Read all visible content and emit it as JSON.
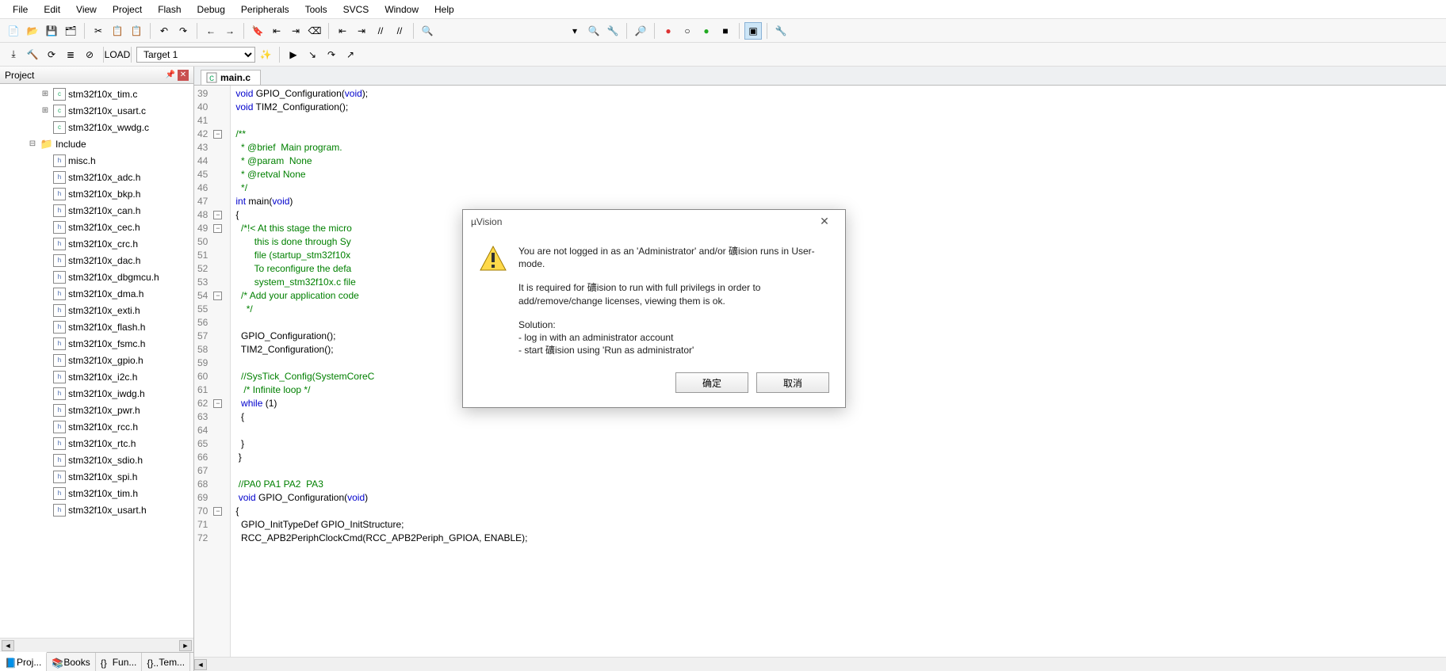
{
  "menubar": [
    "File",
    "Edit",
    "View",
    "Project",
    "Flash",
    "Debug",
    "Peripherals",
    "Tools",
    "SVCS",
    "Window",
    "Help"
  ],
  "toolbar1": {
    "icons": [
      "new",
      "open",
      "save",
      "save-all",
      "",
      "cut",
      "copy",
      "paste",
      "",
      "undo",
      "redo",
      "",
      "nav-back",
      "nav-fwd",
      "",
      "bookmark",
      "bm-prev",
      "bm-next",
      "bm-clear",
      "",
      "outdent",
      "indent",
      "comment",
      "uncomment",
      "",
      "find-in-files"
    ],
    "right_icons": [
      "dropdown-field",
      "find",
      "find-config",
      "",
      "zoom",
      "",
      "rec-red",
      "rec-clear",
      "rec-green",
      "rec-stop",
      "",
      "window-layout",
      "",
      "wrench"
    ]
  },
  "toolbar2": {
    "icons": [
      "translate",
      "build",
      "rebuild",
      "batch",
      "stop",
      "",
      "load"
    ],
    "target_label": "Target 1",
    "right_icons": [
      "options",
      "",
      "debug-start",
      "debug-step",
      "debug-over",
      "debug-out"
    ]
  },
  "project": {
    "title": "Project",
    "tree": [
      {
        "depth": 3,
        "tw": "⊞",
        "icon": "c",
        "label": "stm32f10x_tim.c"
      },
      {
        "depth": 3,
        "tw": "⊞",
        "icon": "c",
        "label": "stm32f10x_usart.c"
      },
      {
        "depth": 3,
        "tw": "",
        "icon": "c",
        "label": "stm32f10x_wwdg.c"
      },
      {
        "depth": 2,
        "tw": "⊟",
        "icon": "folder",
        "label": "Include"
      },
      {
        "depth": 3,
        "tw": "",
        "icon": "h",
        "label": "misc.h"
      },
      {
        "depth": 3,
        "tw": "",
        "icon": "h",
        "label": "stm32f10x_adc.h"
      },
      {
        "depth": 3,
        "tw": "",
        "icon": "h",
        "label": "stm32f10x_bkp.h"
      },
      {
        "depth": 3,
        "tw": "",
        "icon": "h",
        "label": "stm32f10x_can.h"
      },
      {
        "depth": 3,
        "tw": "",
        "icon": "h",
        "label": "stm32f10x_cec.h"
      },
      {
        "depth": 3,
        "tw": "",
        "icon": "h",
        "label": "stm32f10x_crc.h"
      },
      {
        "depth": 3,
        "tw": "",
        "icon": "h",
        "label": "stm32f10x_dac.h"
      },
      {
        "depth": 3,
        "tw": "",
        "icon": "h",
        "label": "stm32f10x_dbgmcu.h"
      },
      {
        "depth": 3,
        "tw": "",
        "icon": "h",
        "label": "stm32f10x_dma.h"
      },
      {
        "depth": 3,
        "tw": "",
        "icon": "h",
        "label": "stm32f10x_exti.h"
      },
      {
        "depth": 3,
        "tw": "",
        "icon": "h",
        "label": "stm32f10x_flash.h"
      },
      {
        "depth": 3,
        "tw": "",
        "icon": "h",
        "label": "stm32f10x_fsmc.h"
      },
      {
        "depth": 3,
        "tw": "",
        "icon": "h",
        "label": "stm32f10x_gpio.h"
      },
      {
        "depth": 3,
        "tw": "",
        "icon": "h",
        "label": "stm32f10x_i2c.h"
      },
      {
        "depth": 3,
        "tw": "",
        "icon": "h",
        "label": "stm32f10x_iwdg.h"
      },
      {
        "depth": 3,
        "tw": "",
        "icon": "h",
        "label": "stm32f10x_pwr.h"
      },
      {
        "depth": 3,
        "tw": "",
        "icon": "h",
        "label": "stm32f10x_rcc.h"
      },
      {
        "depth": 3,
        "tw": "",
        "icon": "h",
        "label": "stm32f10x_rtc.h"
      },
      {
        "depth": 3,
        "tw": "",
        "icon": "h",
        "label": "stm32f10x_sdio.h"
      },
      {
        "depth": 3,
        "tw": "",
        "icon": "h",
        "label": "stm32f10x_spi.h"
      },
      {
        "depth": 3,
        "tw": "",
        "icon": "h",
        "label": "stm32f10x_tim.h"
      },
      {
        "depth": 3,
        "tw": "",
        "icon": "h",
        "label": "stm32f10x_usart.h"
      }
    ],
    "bottom_tabs": [
      {
        "label": "Proj...",
        "active": true
      },
      {
        "label": "Books",
        "active": false
      },
      {
        "label": "Fun...",
        "active": false
      },
      {
        "label": "Tem...",
        "active": false
      }
    ]
  },
  "editor": {
    "tab": "main.c",
    "first_line": 39,
    "fold_minus": [
      42,
      48,
      49,
      54,
      62,
      70
    ],
    "fold_plus": [],
    "lines": [
      [
        [
          "kw",
          "void"
        ],
        [
          "",
          " GPIO_Configuration("
        ],
        [
          "kw",
          "void"
        ],
        [
          "",
          ");"
        ]
      ],
      [
        [
          "kw",
          "void"
        ],
        [
          "",
          " TIM2_Configuration();"
        ]
      ],
      [
        [
          "",
          ""
        ]
      ],
      [
        [
          "cm",
          "/**"
        ]
      ],
      [
        [
          "cm",
          "  * @brief  Main program."
        ]
      ],
      [
        [
          "cm",
          "  * @param  None"
        ]
      ],
      [
        [
          "cm",
          "  * @retval None"
        ]
      ],
      [
        [
          "cm",
          "  */"
        ]
      ],
      [
        [
          "kw",
          "int"
        ],
        [
          "",
          " main("
        ],
        [
          "kw",
          "void"
        ],
        [
          "",
          ")"
        ]
      ],
      [
        [
          "",
          "{"
        ]
      ],
      [
        [
          "cm",
          "  /*!< At this stage the micro"
        ]
      ],
      [
        [
          "cm",
          "       this is done through Sy"
        ]
      ],
      [
        [
          "cm",
          "       file (startup_stm32f10x"
        ]
      ],
      [
        [
          "cm",
          "       To reconfigure the defa"
        ]
      ],
      [
        [
          "cm",
          "       system_stm32f10x.c file"
        ]
      ],
      [
        [
          "cm",
          "  /* Add your application code"
        ]
      ],
      [
        [
          "cm",
          "    */"
        ]
      ],
      [
        [
          "",
          ""
        ]
      ],
      [
        [
          "",
          "  GPIO_Configuration();"
        ]
      ],
      [
        [
          "",
          "  TIM2_Configuration();"
        ]
      ],
      [
        [
          "",
          ""
        ]
      ],
      [
        [
          "cm",
          "  //SysTick_Config(SystemCoreC"
        ]
      ],
      [
        [
          "cm",
          "   /* Infinite loop */"
        ]
      ],
      [
        [
          "",
          "  "
        ],
        [
          "kw",
          "while"
        ],
        [
          "",
          " (1)"
        ]
      ],
      [
        [
          "",
          "  {"
        ]
      ],
      [
        [
          "",
          ""
        ]
      ],
      [
        [
          "",
          "  }"
        ]
      ],
      [
        [
          "",
          " }"
        ]
      ],
      [
        [
          "",
          ""
        ]
      ],
      [
        [
          "cm",
          " //PA0 PA1 PA2  PA3"
        ]
      ],
      [
        [
          "",
          " "
        ],
        [
          "kw",
          "void"
        ],
        [
          "",
          " GPIO_Configuration("
        ],
        [
          "kw",
          "void"
        ],
        [
          "",
          ")"
        ]
      ],
      [
        [
          "",
          "{"
        ]
      ],
      [
        [
          "",
          "  GPIO_InitTypeDef GPIO_InitStructure;"
        ]
      ],
      [
        [
          "",
          "  RCC_APB2PeriphClockCmd(RCC_APB2Periph_GPIOA, ENABLE);"
        ]
      ]
    ]
  },
  "dialog": {
    "title": "µVision",
    "p1": "You are not logged in as an 'Administrator' and/or 礦ision runs in User-mode.",
    "p2": "It is required for 礦ision to run with full privilegs in order to add/remove/change licenses, viewing them is ok.",
    "p3": "Solution:",
    "p4a": " - log in with an administrator account",
    "p4b": " - start 礦ision using 'Run as administrator'",
    "ok": "确定",
    "cancel": "取消"
  }
}
